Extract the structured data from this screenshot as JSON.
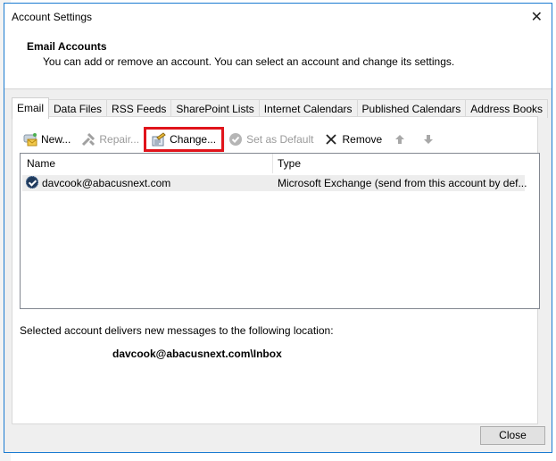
{
  "window": {
    "title": "Account Settings",
    "close_icon": "close-x-icon"
  },
  "header": {
    "title": "Email Accounts",
    "description": "You can add or remove an account. You can select an account and change its settings."
  },
  "tabs": [
    {
      "label": "Email",
      "active": true
    },
    {
      "label": "Data Files",
      "active": false
    },
    {
      "label": "RSS Feeds",
      "active": false
    },
    {
      "label": "SharePoint Lists",
      "active": false
    },
    {
      "label": "Internet Calendars",
      "active": false
    },
    {
      "label": "Published Calendars",
      "active": false
    },
    {
      "label": "Address Books",
      "active": false
    }
  ],
  "toolbar": {
    "new_label": "New...",
    "repair_label": "Repair...",
    "change_label": "Change...",
    "set_default_label": "Set as Default",
    "remove_label": "Remove",
    "move_up_icon": "arrow-up-icon",
    "move_down_icon": "arrow-down-icon"
  },
  "list": {
    "columns": [
      "Name",
      "Type"
    ],
    "rows": [
      {
        "name": "davcook@abacusnext.com",
        "type": "Microsoft Exchange (send from this account by def..."
      }
    ]
  },
  "delivery": {
    "label": "Selected account delivers new messages to the following location:",
    "location": "davcook@abacusnext.com\\Inbox"
  },
  "footer": {
    "close_label": "Close"
  },
  "colors": {
    "accent_border": "#1a7bd1",
    "highlight_box": "#e0141b"
  }
}
